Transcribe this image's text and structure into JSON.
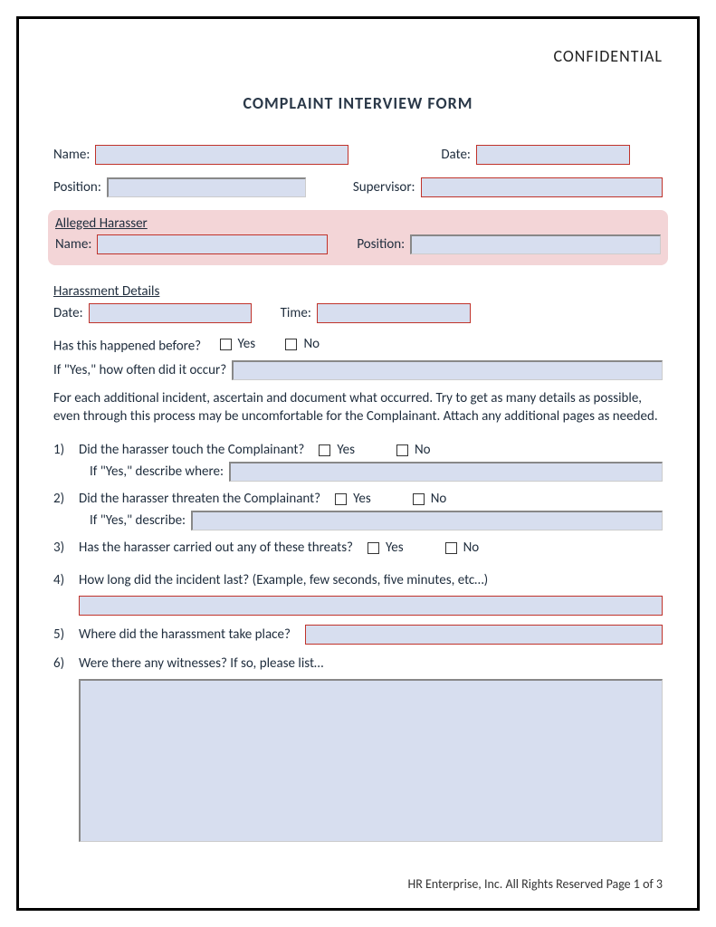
{
  "header": {
    "confidential": "CONFIDENTIAL",
    "title": "COMPLAINT INTERVIEW FORM"
  },
  "complainant": {
    "name_label": "Name:",
    "date_label": "Date:",
    "position_label": "Position:",
    "supervisor_label": "Supervisor:"
  },
  "harasser": {
    "section": "Alleged Harasser",
    "name_label": "Name:",
    "position_label": "Position:"
  },
  "details": {
    "section": "Harassment Details",
    "date_label": "Date:",
    "time_label": "Time:",
    "happened_before": "Has this happened before?",
    "yes": "Yes",
    "no": "No",
    "often": "If \"Yes,\" how often did it occur?",
    "instruction": "For each additional incident, ascertain and document what occurred. Try to get as many details as possible, even through this process may be uncomfortable for the Complainant. Attach any additional pages as needed."
  },
  "questions": {
    "q1": {
      "num": "1)",
      "text": "Did the harasser touch the Complainant?",
      "sub": "If \"Yes,\" describe where:"
    },
    "q2": {
      "num": "2)",
      "text": "Did the harasser threaten the Complainant?",
      "sub": "If \"Yes,\" describe:"
    },
    "q3": {
      "num": "3)",
      "text": "Has the harasser carried out any of these threats?"
    },
    "q4": {
      "num": "4)",
      "text": "How long did the incident last? (Example, few seconds, five minutes, etc…)"
    },
    "q5": {
      "num": "5)",
      "text": "Where did the harassment take place?"
    },
    "q6": {
      "num": "6)",
      "text": "Were there any witnesses? If so, please list…"
    }
  },
  "footer": {
    "text": "HR Enterprise, Inc.  All Rights Reserved  Page 1 of 3"
  }
}
